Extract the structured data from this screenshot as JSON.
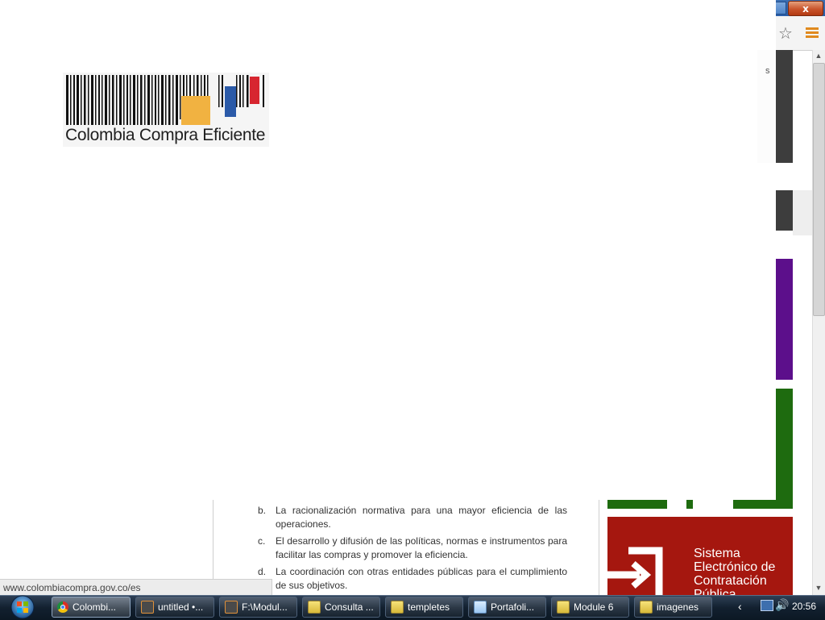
{
  "browser": {
    "close_symbol": "x",
    "star_icon": "star-icon",
    "menu_icon": "menu-icon",
    "fragment_text": "s"
  },
  "logo": {
    "text": "Colombia Compra Eficiente",
    "colors": {
      "orange": "#f1b241",
      "blue": "#2b5aa8",
      "red": "#d72630"
    }
  },
  "content": {
    "list": [
      {
        "letter": "b.",
        "text": "La racionalización normativa para una mayor eficiencia de las operaciones."
      },
      {
        "letter": "c.",
        "text": "El desarrollo y difusión de las políticas, normas e instrumentos para facilitar las compras y promover la eficiencia."
      },
      {
        "letter": "d.",
        "text": "La coordinación con otras entidades públicas para el cumplimiento de sus objetivos."
      }
    ],
    "secop_text": "Sistema Electrónico de Contratación Pública",
    "secop_color": "#a5170f",
    "green_color": "#1e6b0f",
    "purple_color": "#5c0f8b"
  },
  "status": {
    "url": "www.colombiacompra.gov.co/es"
  },
  "taskbar": {
    "items": [
      {
        "label": "Colombi...",
        "icon": "chrome-icon",
        "active": true
      },
      {
        "label": "untitled •...",
        "icon": "sublime-icon",
        "active": false
      },
      {
        "label": "F:\\Modul...",
        "icon": "sublime-icon",
        "active": false
      },
      {
        "label": "Consulta ...",
        "icon": "folder-icon",
        "active": false
      },
      {
        "label": "templetes",
        "icon": "folder-icon",
        "active": false
      },
      {
        "label": "Portafoli...",
        "icon": "notepad-icon",
        "active": false
      },
      {
        "label": "Module 6",
        "icon": "folder-icon",
        "active": false
      },
      {
        "label": "imagenes",
        "icon": "folder-icon",
        "active": false
      }
    ],
    "clock": "20:56"
  }
}
